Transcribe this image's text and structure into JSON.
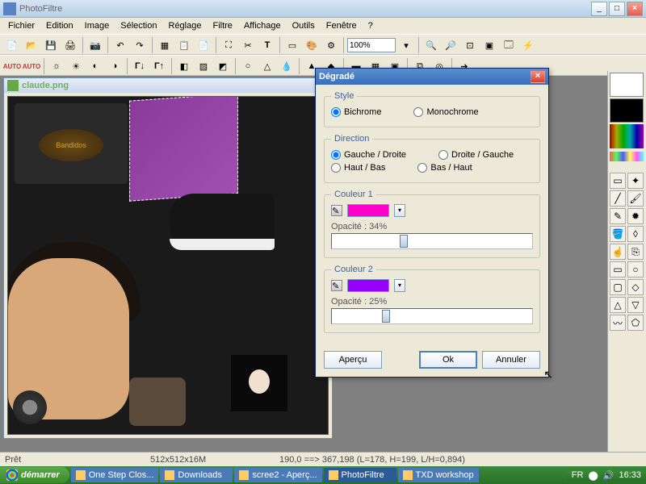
{
  "app": {
    "title": "PhotoFiltre"
  },
  "menu": [
    "Fichier",
    "Edition",
    "Image",
    "Sélection",
    "Réglage",
    "Filtre",
    "Affichage",
    "Outils",
    "Fenêtre",
    "?"
  ],
  "toolbar": {
    "zoom": "100%"
  },
  "document": {
    "title": "claude.png",
    "patch_text": "Bandidos"
  },
  "dialog": {
    "title": "Dégradé",
    "style": {
      "legend": "Style",
      "opt1": "Bichrome",
      "opt2": "Monochrome"
    },
    "direction": {
      "legend": "Direction",
      "opt1": "Gauche / Droite",
      "opt2": "Droite / Gauche",
      "opt3": "Haut / Bas",
      "opt4": "Bas / Haut"
    },
    "color1": {
      "legend": "Couleur 1",
      "opacity_label": "Opacité : 34%",
      "opacity_percent": 34,
      "hex": "#ff00cc"
    },
    "color2": {
      "legend": "Couleur 2",
      "opacity_label": "Opacité : 25%",
      "opacity_percent": 25,
      "hex": "#9900ff"
    },
    "buttons": {
      "preview": "Aperçu",
      "ok": "Ok",
      "cancel": "Annuler"
    }
  },
  "status": {
    "ready": "Prêt",
    "dims": "512x512x16M",
    "coords": "190,0 ==> 367,198 (L=178, H=199, L/H=0,894)"
  },
  "taskbar": {
    "start": "démarrer",
    "tasks": [
      "One Step Clos...",
      "Downloads",
      "scree2 - Aperç...",
      "PhotoFiltre",
      "TXD workshop"
    ],
    "active_index": 3,
    "lang": "FR",
    "clock": "16:33"
  }
}
